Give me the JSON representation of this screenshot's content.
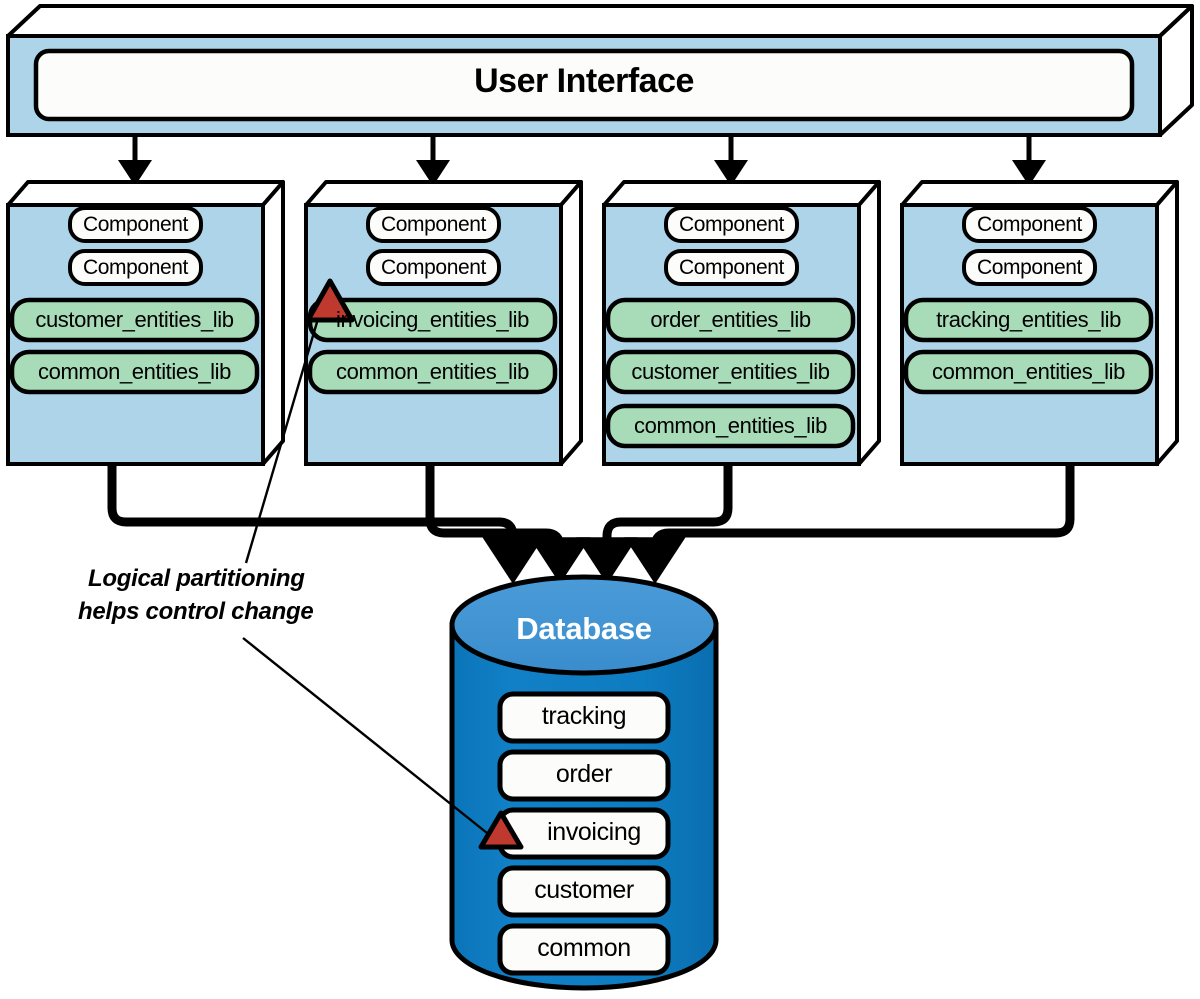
{
  "diagram": {
    "title_ui": "User Interface",
    "database": {
      "title": "Database",
      "tables": [
        {
          "name": "tracking",
          "marked": false
        },
        {
          "name": "order",
          "marked": false
        },
        {
          "name": "invoicing",
          "marked": true
        },
        {
          "name": "customer",
          "marked": false
        },
        {
          "name": "common",
          "marked": false
        }
      ]
    },
    "services": [
      {
        "id": "customer-service",
        "components": [
          "Component",
          "Component"
        ],
        "libs": [
          "customer_entities_lib",
          "common_entities_lib"
        ],
        "marked_lib": null
      },
      {
        "id": "invoicing-service",
        "components": [
          "Component",
          "Component"
        ],
        "libs": [
          "invoicing_entities_lib",
          "common_entities_lib"
        ],
        "marked_lib": "invoicing_entities_lib"
      },
      {
        "id": "order-service",
        "components": [
          "Component",
          "Component"
        ],
        "libs": [
          "order_entities_lib",
          "customer_entities_lib",
          "common_entities_lib"
        ],
        "marked_lib": null
      },
      {
        "id": "tracking-service",
        "components": [
          "Component",
          "Component"
        ],
        "libs": [
          "tracking_entities_lib",
          "common_entities_lib"
        ],
        "marked_lib": null
      }
    ],
    "annotation": {
      "line1": "Logical partitioning",
      "line2": "helps control change"
    },
    "colors": {
      "service_fill": "#aed4ea",
      "service_top": "#ffffff",
      "lib_fill": "#a8dcb8",
      "component_fill": "#fcfcfa",
      "db_body": "#0f7dc2",
      "db_top": "#3e93d3",
      "db_table_fill": "#fcfcfa",
      "marker_red": "#c0392f",
      "stroke": "#000000"
    }
  }
}
